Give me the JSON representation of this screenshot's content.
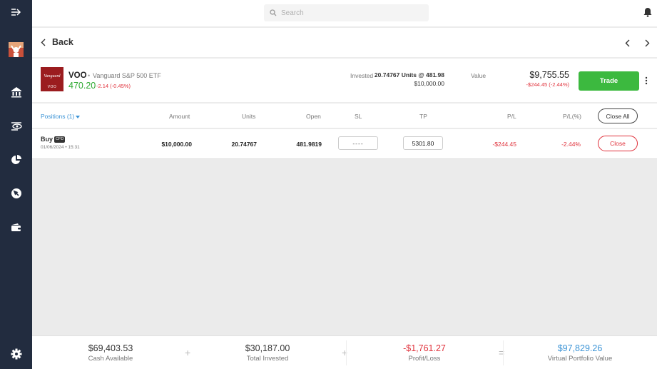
{
  "topbar": {
    "search_placeholder": "Search"
  },
  "back_row": {
    "back_label": "Back"
  },
  "instrument": {
    "logo_brand": "Vanguard",
    "logo_ticker": "VOO",
    "symbol": "VOO",
    "separator": "•",
    "name": "Vanguard S&P 500 ETF",
    "price": "470.20",
    "change": "-2.14 (-0.45%)",
    "invested_label": "Invested",
    "units_text": "20.74767 Units @ 481.98",
    "invested_amount": "$10,000.00",
    "value_label": "Value",
    "value_amount": "$9,755.55",
    "value_change": "-$244.45 (-2.44%)",
    "trade_label": "Trade"
  },
  "table": {
    "headers": {
      "positions": "Positions (1)",
      "amount": "Amount",
      "units": "Units",
      "open": "Open",
      "sl": "SL",
      "tp": "TP",
      "pl": "P/L",
      "pl_pct": "P/L(%)"
    },
    "close_all_label": "Close All",
    "rows": [
      {
        "side": "Buy",
        "badge": "CFD",
        "date": "01/06/2024 • 15:31",
        "amount": "$10,000.00",
        "units": "20.74767",
        "open": "481.9819",
        "sl": "----",
        "tp": "5301.80",
        "pl": "-$244.45",
        "pl_pct": "-2.44%",
        "close_label": "Close"
      }
    ]
  },
  "footer": {
    "cash": {
      "value": "$69,403.53",
      "label": "Cash Available"
    },
    "invested": {
      "value": "$30,187.00",
      "label": "Total Invested"
    },
    "profit": {
      "value": "-$1,761.27",
      "label": "Profit/Loss"
    },
    "portfolio": {
      "value": "$97,829.26",
      "label": "Virtual Portfolio Value"
    },
    "op_plus": "+",
    "op_equals": "="
  },
  "colors": {
    "sidebar": "#222c3f",
    "positive": "#2ba82f",
    "negative": "#e0313b",
    "accent_blue": "#3c94d6",
    "trade_green": "#3cb93f"
  }
}
